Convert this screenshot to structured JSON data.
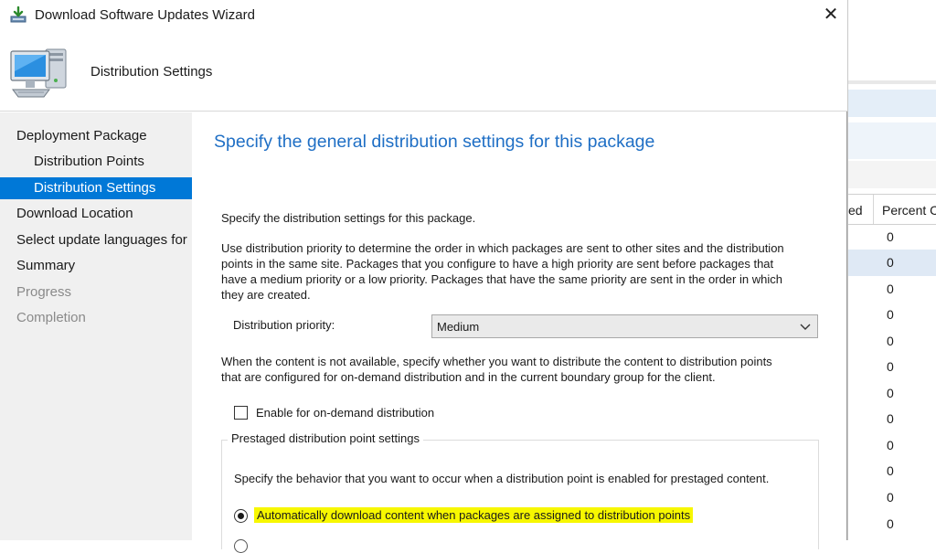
{
  "window": {
    "title": "Download Software Updates Wizard",
    "close_glyph": "✕",
    "banner_heading": "Distribution Settings"
  },
  "sidebar": {
    "items": [
      {
        "label": "Deployment Package",
        "state": "normal"
      },
      {
        "label": "Distribution Points",
        "state": "normal"
      },
      {
        "label": "Distribution Settings",
        "state": "active"
      },
      {
        "label": "Download Location",
        "state": "normal"
      },
      {
        "label": "Select update languages for",
        "state": "normal"
      },
      {
        "label": "Summary",
        "state": "normal"
      },
      {
        "label": "Progress",
        "state": "disabled"
      },
      {
        "label": "Completion",
        "state": "disabled"
      }
    ]
  },
  "content": {
    "heading": "Specify the general distribution settings for this package",
    "intro": "Specify the distribution settings for this package.",
    "priority_desc_line1": "Use distribution priority to determine the order in which packages are sent to other sites and the distribution",
    "priority_desc_line2": "points in the same site. Packages that you configure to have a high priority are sent before packages that",
    "priority_desc_line3": "have a medium priority or a low priority. Packages that have the same priority are sent in the order in which",
    "priority_desc_line4": "they are created.",
    "priority_label": "Distribution priority:",
    "priority_value": "Medium",
    "ondemand_desc_line1": "When the content is not available, specify whether you want to distribute the content to distribution points",
    "ondemand_desc_line2": "that are configured for on-demand distribution and in the current boundary group for the client.",
    "ondemand_checkbox_label": "Enable for on-demand distribution",
    "ondemand_checked": false,
    "prestaged_group_title": "Prestaged distribution point settings",
    "prestaged_desc": "Specify the behavior that you want to occur when a distribution point is enabled for prestaged content.",
    "prestaged_option1_label": "Automatically download content when packages are assigned to distribution points",
    "prestaged_option1_selected": true,
    "highlight_color": "#f7f700"
  },
  "background_app": {
    "col1_header": "ed",
    "col2_header": "Percent C",
    "rows": [
      "0",
      "0",
      "0",
      "0",
      "0",
      "0",
      "0",
      "0",
      "0",
      "0",
      "0",
      "0"
    ]
  },
  "colors": {
    "accent": "#0078d7",
    "heading_blue": "#1f6fc5",
    "sidebar_bg": "#f0f0f0"
  },
  "icons": {
    "app": "download-wizard-icon",
    "banner": "computer-icon",
    "dropdown": "chevron-down-icon",
    "close": "close-icon"
  }
}
